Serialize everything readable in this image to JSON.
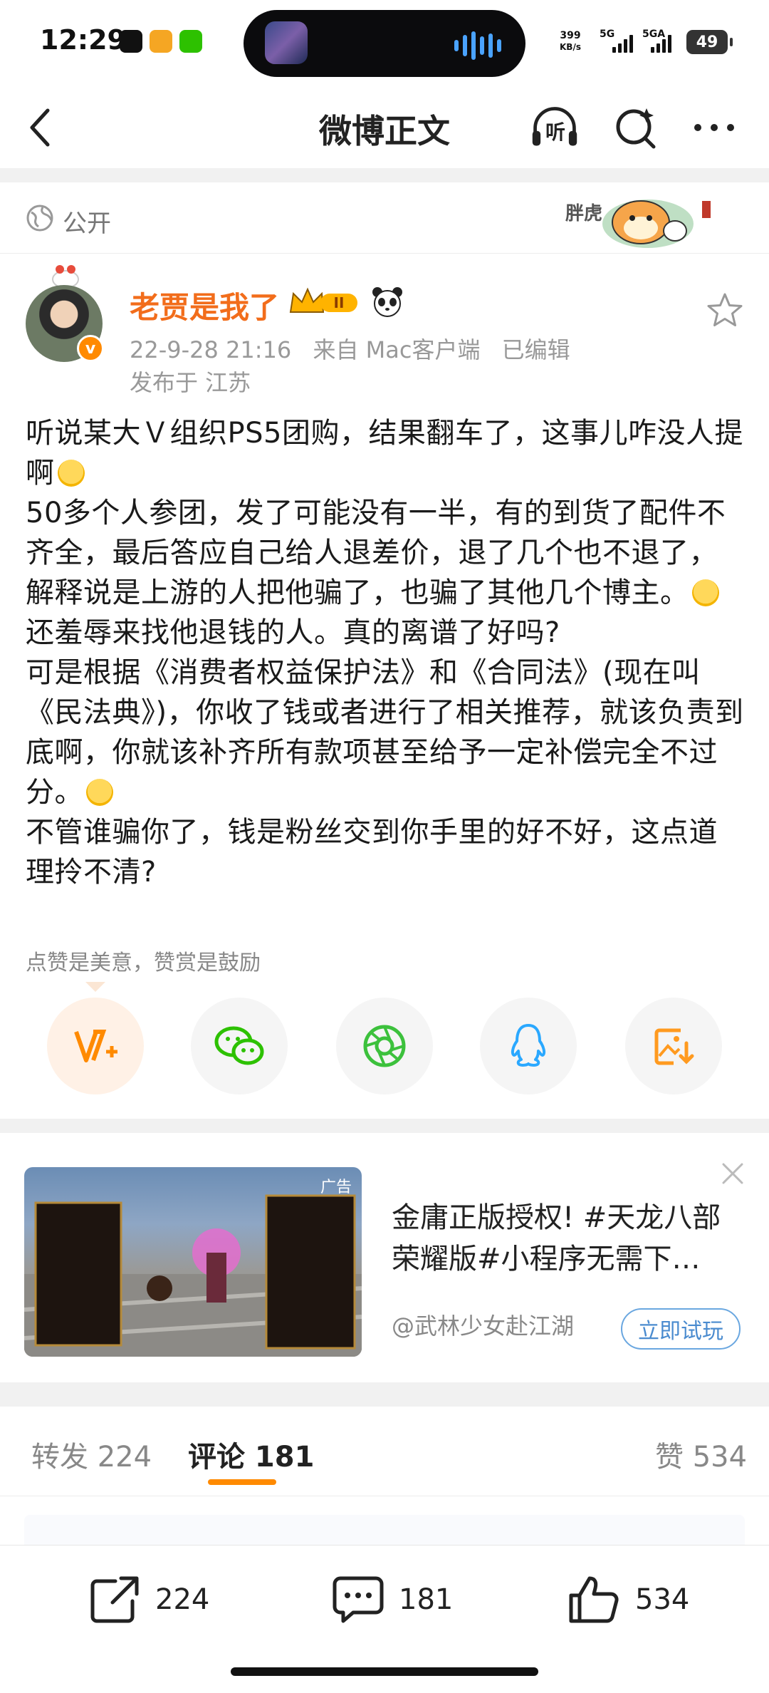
{
  "status_bar": {
    "time": "12:29",
    "net_speed_value": "399",
    "net_speed_unit": "KB/s",
    "sim1": "5G",
    "sim2": "5GA",
    "battery": "49"
  },
  "nav": {
    "title": "微博正文",
    "listen_label": "听"
  },
  "visibility": {
    "label": "公开",
    "sticker_text": "胖虎"
  },
  "author": {
    "name": "老贾是我了",
    "badge_level": "II",
    "verified": "v",
    "date": "22-9-28 21:16",
    "source": "来自 Mac客户端",
    "edited": "已编辑",
    "location": "发布于 江苏"
  },
  "post": {
    "p1": "听说某大Ｖ组织PS5团购，结果翻车了，这事儿咋没人提啊",
    "p2": "50多个人参团，发了可能没有一半，有的到货了配件不齐全，最后答应自己给人退差价，退了几个也不退了，解释说是上游的人把他骗了，也骗了其他几个博主。",
    "p3": "还羞辱来找他退钱的人。真的离谱了好吗?",
    "p4": "可是根据《消费者权益保护法》和《合同法》(现在叫《民法典》)，你收了钱或者进行了相关推荐，就该负责到底啊，你就该补齐所有款项甚至给予一定补偿完全不过分。",
    "p5": "不管谁骗你了，钱是粉丝交到你手里的好不好，这点道理拎不清?"
  },
  "reward_tip": "点赞是美意，赞赏是鼓励",
  "share_icons": [
    "reward-icon",
    "wechat-icon",
    "moments-icon",
    "qq-icon",
    "save-image-icon"
  ],
  "ad": {
    "tag": "广告",
    "title": "金庸正版授权! #天龙八部荣耀版#小程序无需下…",
    "source": "@武林少女赴江湖",
    "cta": "立即试玩"
  },
  "tabs": {
    "repost": "转发 224",
    "comment": "评论 181",
    "like": "赞 534"
  },
  "bottom_bar": {
    "repost_count": "224",
    "comment_count": "181",
    "like_count": "534"
  },
  "colors": {
    "accent": "#ff8a00",
    "author_name": "#f26d1b",
    "link_blue": "#4a8bcf"
  }
}
